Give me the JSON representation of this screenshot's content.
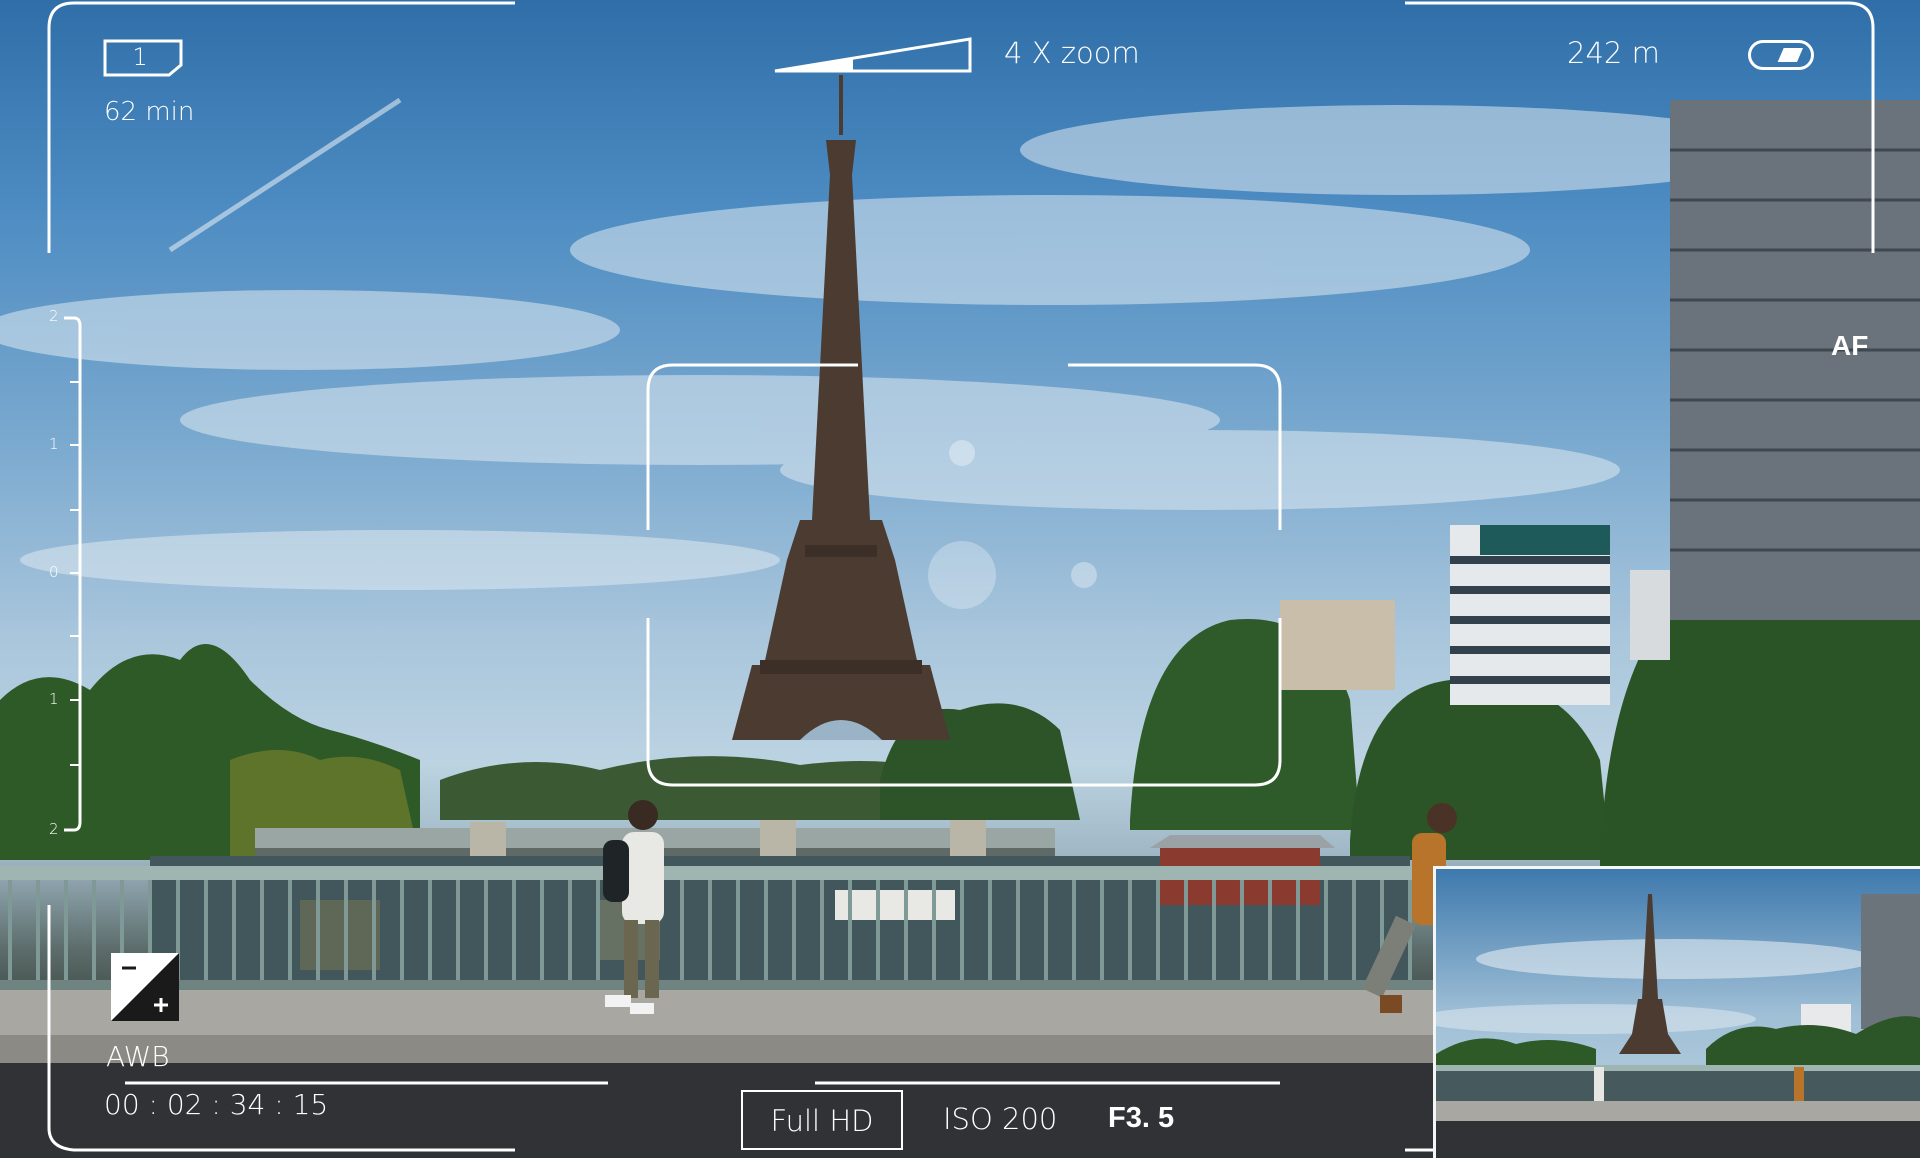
{
  "viewfinder": {
    "shot_counter": "1",
    "remaining_time": "62 min",
    "zoom_label": "4 X zoom",
    "distance": "242 m",
    "af_label": "AF",
    "awb_label": "AWB",
    "timecode": "00 : 02 : 34 : 15",
    "resolution": "Full HD",
    "iso": "ISO 200",
    "aperture": "F3. 5",
    "exposure_scale": [
      "2",
      "1",
      "0",
      "1",
      "2"
    ],
    "zoom_level_fraction": 0.4,
    "battery_level_fraction": 0.55
  },
  "colors": {
    "hud": "#ffffff",
    "sky_top": "#2f6ea8",
    "sky_mid": "#a9c6dc",
    "tower": "#4a3a30",
    "foliage": "#2f5a2a",
    "water": "#3e5560",
    "railing": "#7f9a96"
  },
  "icons": [
    "battery-icon",
    "exposure-compensation-icon",
    "zoom-wedge-icon",
    "shot-counter-icon"
  ]
}
